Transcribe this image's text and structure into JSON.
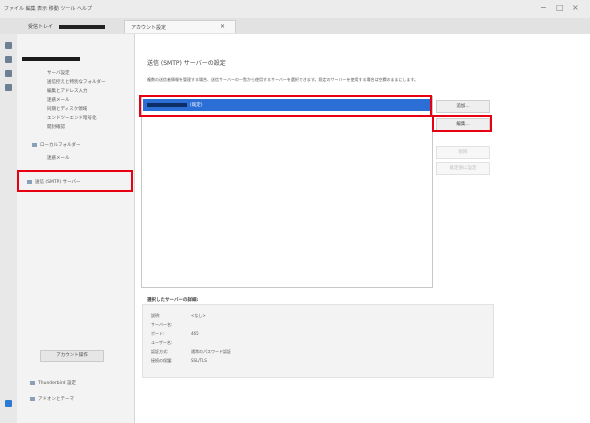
{
  "titlebar": {
    "menu": "ファイル 編集 表示 移動 ツール ヘルプ",
    "window_buttons": [
      "−",
      "□",
      "×"
    ]
  },
  "tabs": [
    {
      "label": "受信トレイ"
    },
    {
      "label": "アカウント設定"
    }
  ],
  "sidebar": {
    "rows": [
      "サーバ設定",
      "送信控えと特別なフォルダー",
      "編集とアドレス入力",
      "迷惑メール",
      "同期とディスク領域",
      "エンドツーエンド暗号化",
      "開封確認",
      "ローカルフォルダー",
      "迷惑メール",
      "送信 (SMTP) サーバー"
    ],
    "actions_button": "アカウント操作",
    "footer_items": [
      "Thunderbird 設定",
      "アドオンとテーマ"
    ]
  },
  "main": {
    "title": "送信 (SMTP) サーバーの設定",
    "description": "複数の送信者情報を管理する場合、送信サーバーの一覧から使用するサーバーを選択できます。既定のサーバーを使用する場合は空欄のままにします。",
    "list": {
      "selected_suffix": "(既定)"
    },
    "buttons": {
      "add": "追加...",
      "edit": "編集...",
      "remove": "削除",
      "set_default": "既定値に設定"
    },
    "details": {
      "heading": "選択したサーバーの詳細:",
      "rows": [
        {
          "label": "説明:",
          "value": "<なし>"
        },
        {
          "label": "サーバー名:",
          "value": ""
        },
        {
          "label": "ポート:",
          "value": "465"
        },
        {
          "label": "ユーザー名:",
          "value": ""
        },
        {
          "label": "認証方式:",
          "value": "通常のパスワード認証"
        },
        {
          "label": "接続の保護:",
          "value": "SSL/TLS"
        }
      ]
    }
  },
  "colors": {
    "accent": "#2b6fd6",
    "highlight_box": "#e60012"
  }
}
